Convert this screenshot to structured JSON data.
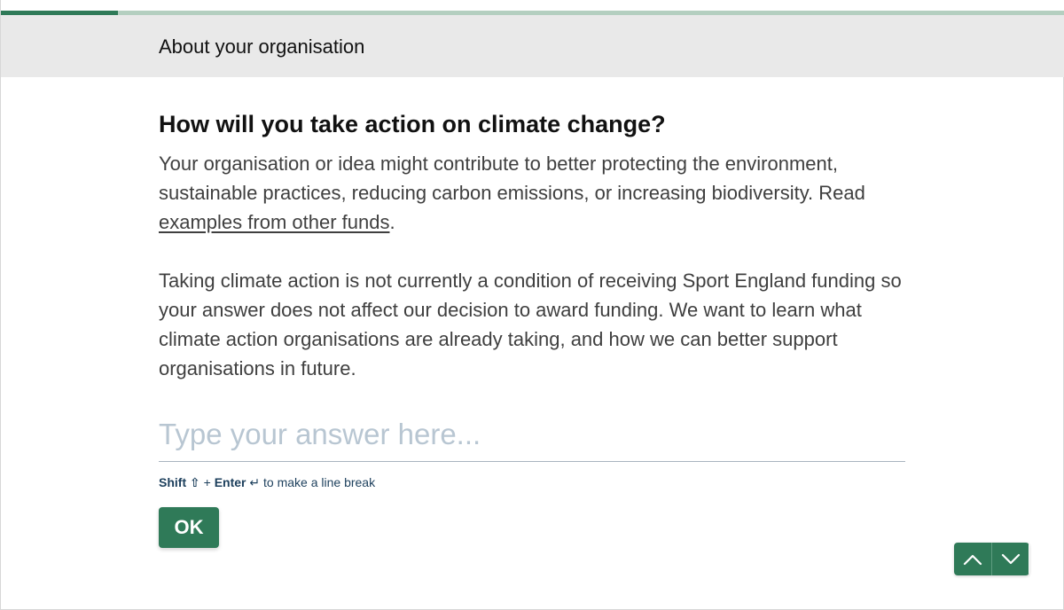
{
  "progress": {
    "value": 0.11,
    "color": "#2f7a58",
    "track_color": "#b4cfc0"
  },
  "header": {
    "title": "About your organisation"
  },
  "question": {
    "title": "How will you take action on climate change?",
    "description_1_before_link": "Your organisation or idea might contribute to better protecting the environment, sustainable practices, reducing carbon emissions, or increasing biodiversity. Read ",
    "description_1_link": "examples from other funds",
    "description_1_after_link": ".",
    "description_2": "Taking climate action is not currently a condition of receiving Sport England funding so your answer does not affect our decision to award funding. We want to learn what climate action organisations are already taking, and how we can better support organisations in future."
  },
  "answer": {
    "placeholder": "Type your answer here...",
    "value": ""
  },
  "hint": {
    "shift_label": "Shift",
    "shift_symbol": "⇧",
    "plus": "+",
    "enter_label": "Enter",
    "enter_symbol": "↵",
    "suffix": "to make a line break"
  },
  "ok_button": {
    "label": "OK"
  },
  "nav": {
    "up_icon": "chevron-up-icon",
    "down_icon": "chevron-down-icon"
  },
  "colors": {
    "accent": "#2f7a58",
    "header_bg": "#e9e9e9",
    "hint_text": "#1c3f5c"
  }
}
